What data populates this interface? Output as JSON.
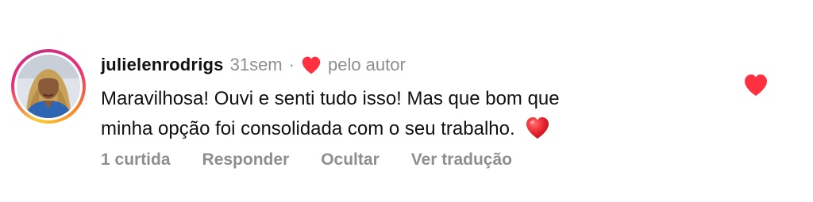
{
  "comment": {
    "username": "julielenrodrigs",
    "time": "31sem",
    "separator": "·",
    "liked_by_author_label": "pelo autor",
    "text_lines": [
      "Maravilhosa! Ouvi e senti tudo isso! Mas que bom que",
      "minha opção foi consolidada com o seu trabalho."
    ],
    "emoji": "red-heart-emoji",
    "actions": {
      "likes": "1 curtida",
      "reply": "Responder",
      "hide": "Ocultar",
      "translate": "Ver tradução"
    }
  },
  "icons": {
    "author_like": "heart-icon",
    "like_button": "heart-filled-icon"
  },
  "colors": {
    "heart_red": "#ff3040",
    "meta_gray": "#8e8e8e",
    "text": "#111111"
  }
}
